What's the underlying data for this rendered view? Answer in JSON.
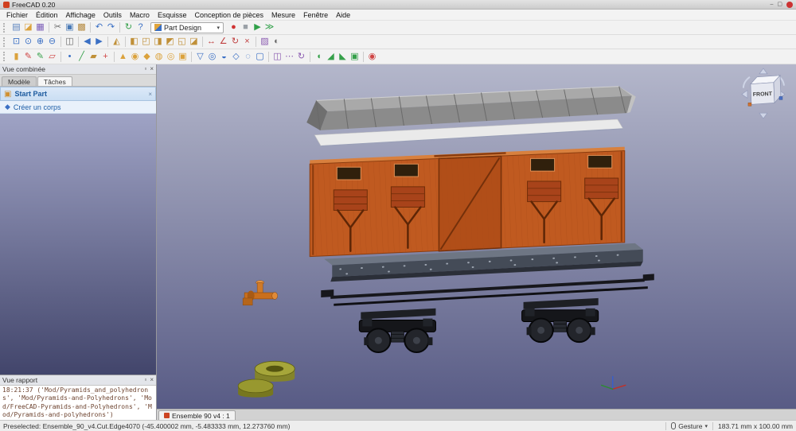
{
  "window": {
    "title": "FreeCAD 0.20",
    "buttons": {
      "minimize": "–",
      "maximize": "▢"
    }
  },
  "glyphs": {
    "panel_float": "▫",
    "panel_close": "×",
    "caret_down": "▾",
    "task_group_icon": "▣",
    "task_group_close": "×",
    "task_action_icon": "◆"
  },
  "menubar": [
    "Fichier",
    "Édition",
    "Affichage",
    "Outils",
    "Macro",
    "Esquisse",
    "Conception de pièces",
    "Mesure",
    "Fenêtre",
    "Aide"
  ],
  "toolbars": {
    "workbench": {
      "label": "Part Design"
    },
    "row1a": [
      {
        "n": "new-file",
        "g": "▤",
        "c": "#5b83bd"
      },
      {
        "n": "open-file",
        "g": "◪",
        "c": "#dba23c"
      },
      {
        "n": "save-file",
        "g": "▦",
        "c": "#7b5cb8"
      },
      {
        "s": 1
      },
      {
        "n": "cut",
        "g": "✂",
        "c": "#6a6a6a"
      },
      {
        "n": "copy",
        "g": "▣",
        "c": "#4a7ab5"
      },
      {
        "n": "paste",
        "g": "▩",
        "c": "#b58a40"
      },
      {
        "s": 1
      },
      {
        "n": "undo",
        "g": "↶",
        "c": "#3a6fc4"
      },
      {
        "n": "redo",
        "g": "↷",
        "c": "#3a6fc4"
      },
      {
        "s": 1
      },
      {
        "n": "refresh",
        "g": "↻",
        "c": "#35a04a"
      },
      {
        "n": "whats-this",
        "g": "?",
        "c": "#3a6fc4"
      }
    ],
    "row1b": [
      {
        "n": "macro-record",
        "g": "●",
        "c": "#cf3333"
      },
      {
        "n": "macro-stop",
        "g": "■",
        "c": "#9aa0a6"
      },
      {
        "n": "macro-execute",
        "g": "▶",
        "c": "#2fa048"
      },
      {
        "n": "macro-debug",
        "g": "≫",
        "c": "#2fa048"
      }
    ],
    "row2": [
      {
        "n": "fit-all",
        "g": "⊡",
        "c": "#3a6fc4"
      },
      {
        "n": "fit-selection",
        "g": "⊙",
        "c": "#3a6fc4"
      },
      {
        "n": "zoom-in",
        "g": "⊕",
        "c": "#3a6fc4"
      },
      {
        "n": "zoom-out",
        "g": "⊖",
        "c": "#3a6fc4"
      },
      {
        "s": 1
      },
      {
        "n": "draw-style",
        "g": "◫",
        "c": "#6a6a6a"
      },
      {
        "s": 1
      },
      {
        "n": "nav-back",
        "g": "◀",
        "c": "#3a6fc4"
      },
      {
        "n": "nav-forward",
        "g": "▶",
        "c": "#3a6fc4"
      },
      {
        "s": 1
      },
      {
        "n": "view-isometric",
        "g": "◭",
        "c": "#c09038"
      },
      {
        "s": 1
      },
      {
        "n": "view-front",
        "g": "◧",
        "c": "#c09038"
      },
      {
        "n": "view-top",
        "g": "◰",
        "c": "#c09038"
      },
      {
        "n": "view-right",
        "g": "◨",
        "c": "#c09038"
      },
      {
        "n": "view-rear",
        "g": "◩",
        "c": "#c09038"
      },
      {
        "n": "view-bottom",
        "g": "◱",
        "c": "#c09038"
      },
      {
        "n": "view-left",
        "g": "◪",
        "c": "#c09038"
      },
      {
        "s": 1
      },
      {
        "n": "measure-linear",
        "g": "↔",
        "c": "#c04040"
      },
      {
        "n": "measure-angular",
        "g": "∠",
        "c": "#c04040"
      },
      {
        "n": "measure-refresh",
        "g": "↻",
        "c": "#c04040"
      },
      {
        "n": "measure-clear",
        "g": "×",
        "c": "#c04040"
      },
      {
        "s": 1
      },
      {
        "n": "texture-mapping",
        "g": "▨",
        "c": "#8a5ab0"
      },
      {
        "n": "toggle-clipping",
        "g": "◐",
        "c": "#6a6a6a"
      }
    ],
    "row3": [
      {
        "n": "create-body",
        "g": "▮",
        "c": "#dba23c"
      },
      {
        "n": "create-sketch",
        "g": "✎",
        "c": "#cf4444"
      },
      {
        "n": "edit-sketch",
        "g": "✎",
        "c": "#35a04a"
      },
      {
        "n": "map-sketch",
        "g": "▱",
        "c": "#cf4444"
      },
      {
        "s": 1
      },
      {
        "n": "datum-point",
        "g": "•",
        "c": "#3a6fc4"
      },
      {
        "n": "datum-line",
        "g": "╱",
        "c": "#35a04a"
      },
      {
        "n": "datum-plane",
        "g": "▰",
        "c": "#c09038"
      },
      {
        "n": "coordinate-system",
        "g": "+",
        "c": "#cf4444"
      },
      {
        "s": 1
      },
      {
        "n": "pad",
        "g": "▲",
        "c": "#dba23c"
      },
      {
        "n": "revolution",
        "g": "◉",
        "c": "#dba23c"
      },
      {
        "n": "additive-loft",
        "g": "◆",
        "c": "#dba23c"
      },
      {
        "n": "additive-pipe",
        "g": "◍",
        "c": "#dba23c"
      },
      {
        "n": "additive-helix",
        "g": "◎",
        "c": "#dba23c"
      },
      {
        "n": "additive-primitive",
        "g": "▣",
        "c": "#dba23c"
      },
      {
        "s": 1
      },
      {
        "n": "pocket",
        "g": "▽",
        "c": "#3a6fc4"
      },
      {
        "n": "hole",
        "g": "◎",
        "c": "#3a6fc4"
      },
      {
        "n": "groove",
        "g": "◒",
        "c": "#3a6fc4"
      },
      {
        "n": "subtractive-loft",
        "g": "◇",
        "c": "#3a6fc4"
      },
      {
        "n": "subtractive-pipe",
        "g": "◌",
        "c": "#3a6fc4"
      },
      {
        "n": "subtractive-primitive",
        "g": "▢",
        "c": "#3a6fc4"
      },
      {
        "s": 1
      },
      {
        "n": "mirrored",
        "g": "◫",
        "c": "#8a5ab0"
      },
      {
        "n": "linear-pattern",
        "g": "⋯",
        "c": "#8a5ab0"
      },
      {
        "n": "polar-pattern",
        "g": "↻",
        "c": "#8a5ab0"
      },
      {
        "s": 1
      },
      {
        "n": "fillet",
        "g": "◖",
        "c": "#35a04a"
      },
      {
        "n": "chamfer",
        "g": "◢",
        "c": "#35a04a"
      },
      {
        "n": "draft",
        "g": "◣",
        "c": "#35a04a"
      },
      {
        "n": "thickness",
        "g": "▣",
        "c": "#35a04a"
      },
      {
        "s": 1
      },
      {
        "n": "boolean-operation",
        "g": "◉",
        "c": "#cf4444"
      }
    ]
  },
  "combo_view": {
    "title": "Vue combinée",
    "tabs": [
      "Modèle",
      "Tâches"
    ],
    "active_tab": "Tâches",
    "task_group": {
      "title": "Start Part",
      "action": "Créer un corps"
    }
  },
  "report_view": {
    "title": "Vue rapport",
    "log": "18:21:37  ('Mod/Pyramids_and_polyhedrons', 'Mod/Pyramids-and-Polyhedrons', 'Mod/FreeCAD-Pyramids-and-Polyhedrons', 'Mod/Pyramids-and-polyhedrons')"
  },
  "viewport": {
    "nav_cube": "FRONT",
    "doc_tab": "Ensemble 90 v4 : 1"
  },
  "statusbar": {
    "left": "Preselected: Ensemble_90_v4.Cut.Edge4070 (-45.400002 mm, -5.483333 mm, 12.273760 mm)",
    "nav_style": "Gesture",
    "size": "183.71 mm x 100.00 mm"
  },
  "colors": {
    "viewport_gradient_top": "#b4b7cb",
    "viewport_gradient_bottom": "#585b85",
    "wagon_body": "#c05a20",
    "wagon_door": "#b14e18",
    "wagon_roof": "#8b8b8b",
    "roof_fascia": "#eaeaea",
    "chassis": "#444b57",
    "bogies": "#15161a",
    "olive_parts": "#a6a63a",
    "brake_part": "#c96f1e",
    "task_header_bg": "#dce9f8",
    "task_link_text": "#2060a8"
  }
}
